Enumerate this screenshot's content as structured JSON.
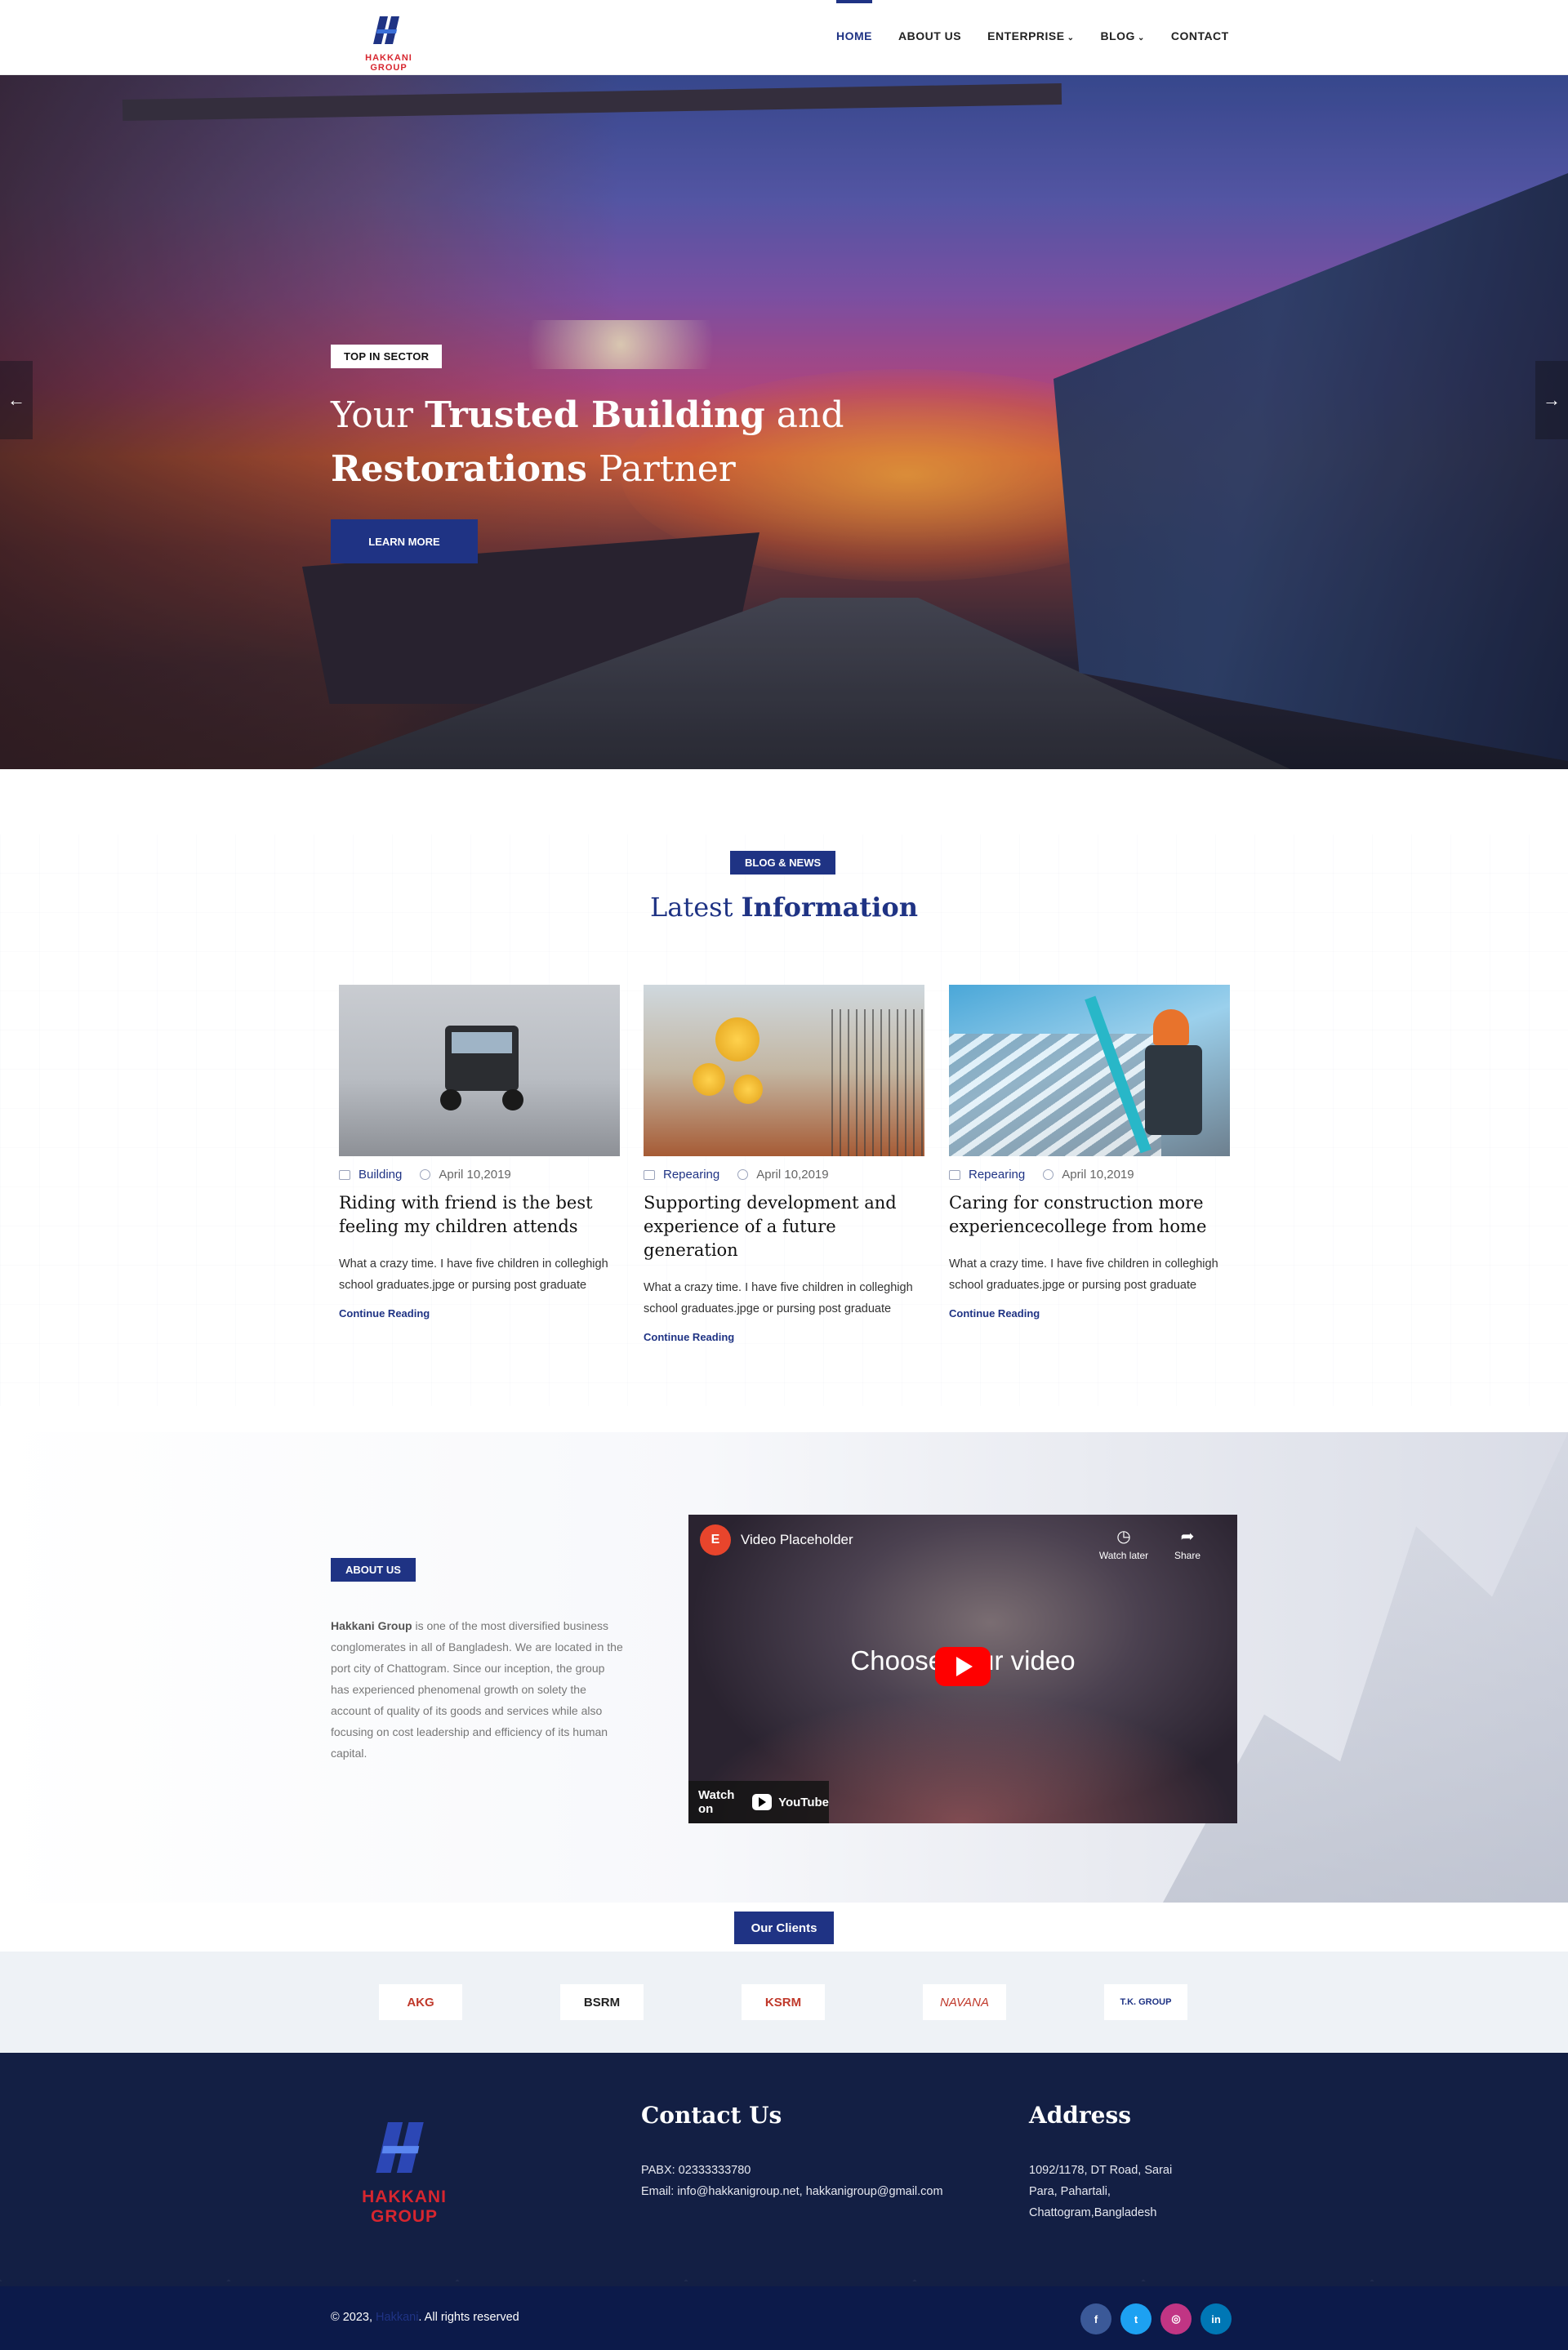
{
  "header": {
    "logo_text": "HAKKANI GROUP",
    "nav": [
      {
        "label": "HOME",
        "active": true,
        "dropdown": false
      },
      {
        "label": "ABOUT US",
        "active": false,
        "dropdown": false
      },
      {
        "label": "ENTERPRISE",
        "active": false,
        "dropdown": true
      },
      {
        "label": "BLOG",
        "active": false,
        "dropdown": true
      },
      {
        "label": "CONTACT",
        "active": false,
        "dropdown": false
      }
    ]
  },
  "hero": {
    "badge": "TOP IN SECTOR",
    "title_part1": "Your ",
    "title_bold1": "Trusted Building",
    "title_part2": " and ",
    "title_bold2": "Restorations",
    "title_part3": " Partner",
    "button": "LEARN MORE",
    "prev_arrow": "←",
    "next_arrow": "→"
  },
  "blog": {
    "tag": "BLOG & NEWS",
    "title_light": "Latest ",
    "title_bold": "Information",
    "cards": [
      {
        "category": "Building",
        "date": "April 10,2019",
        "title": "Riding with friend is the best feeling my children attends",
        "text": "What a crazy time. I have five children in colleghigh school graduates.jpge or pursing post graduate",
        "link": "Continue Reading"
      },
      {
        "category": "Repearing",
        "date": "April 10,2019",
        "title": "Supporting development and experience of a future generation",
        "text": "What a crazy time. I have five children in colleghigh school graduates.jpge or pursing post graduate",
        "link": "Continue Reading"
      },
      {
        "category": "Repearing",
        "date": "April 10,2019",
        "title": "Caring for construction more experiencecollege from home",
        "text": "What a crazy time. I have five children in colleghigh school graduates.jpge or pursing post graduate",
        "link": "Continue Reading"
      }
    ]
  },
  "about": {
    "tag": "ABOUT US",
    "company": "Hakkani Group",
    "text": " is one of the most diversified business conglomerates in all of Bangladesh. We are located in the port city of Chattogram. Since our inception, the group has experienced phenomenal growth on solety the account of quality of its goods and services while also focusing on cost leadership and efficiency of its human capital.",
    "video": {
      "title": "Video Placeholder",
      "watch_later": "Watch later",
      "share": "Share",
      "center_text": "Choose your video",
      "watch_on": "Watch on",
      "youtube": "YouTube"
    }
  },
  "clients": {
    "button": "Our Clients",
    "logos": [
      {
        "name": "AKG",
        "color": "#c0392b"
      },
      {
        "name": "BSRM",
        "color": "#222222"
      },
      {
        "name": "KSRM",
        "color": "#c0392b"
      },
      {
        "name": "NAVANA",
        "color": "#c0392b"
      },
      {
        "name": "T.K. GROUP",
        "color": "#1f3384"
      }
    ]
  },
  "footer": {
    "logo_text": "HAKKANI GROUP",
    "contact_title": "Contact Us",
    "contact_lines": [
      "PABX: 02333333780",
      "Email: info@hakkanigroup.net, hakkanigroup@gmail.com"
    ],
    "address_title": "Address",
    "address_lines": [
      "1092/1178, DT Road, Sarai",
      "Para, Pahartali,",
      "Chattogram,Bangladesh"
    ],
    "copyright_prefix": "© 2023, ",
    "copyright_brand": "Hakkani",
    "copyright_suffix": ". All rights reserved",
    "social": [
      {
        "icon": "facebook-icon",
        "glyph": "f",
        "color": "#3b5998"
      },
      {
        "icon": "twitter-icon",
        "glyph": "t",
        "color": "#1da1f2"
      },
      {
        "icon": "instagram-icon",
        "glyph": "◎",
        "color": "#c13584"
      },
      {
        "icon": "linkedin-icon",
        "glyph": "in",
        "color": "#0077b5"
      }
    ]
  },
  "colors": {
    "brand": "#1f3384",
    "logo_red": "#d7262f",
    "footer_bg": "#131f44"
  }
}
